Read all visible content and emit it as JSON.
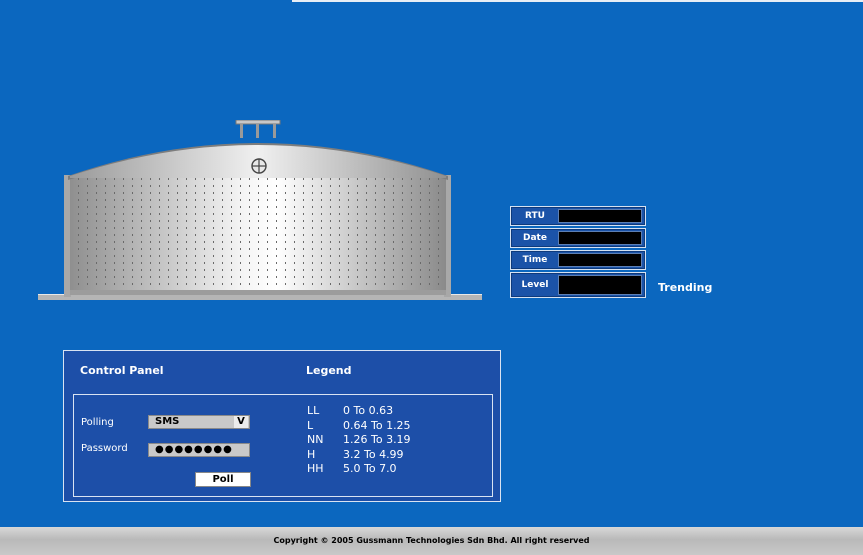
{
  "readout": {
    "rows": [
      {
        "label": "RTU",
        "value": ""
      },
      {
        "label": "Date",
        "value": ""
      },
      {
        "label": "Time",
        "value": ""
      },
      {
        "label": "Level",
        "value": ""
      }
    ],
    "trending_label": "Trending"
  },
  "control_panel": {
    "title": "Control Panel",
    "polling_label": "Polling",
    "polling_value": "SMS",
    "password_label": "Password",
    "password_mask": "●●●●●●●●",
    "poll_button": "Poll"
  },
  "legend": {
    "title": "Legend",
    "items": [
      {
        "code": "LL",
        "range": "0 To 0.63"
      },
      {
        "code": "L",
        "range": "0.64 To 1.25"
      },
      {
        "code": "NN",
        "range": "1.26 To 3.19"
      },
      {
        "code": "H",
        "range": "3.2 To 4.99"
      },
      {
        "code": "HH",
        "range": "5.0 To 7.0"
      }
    ]
  },
  "footer": {
    "copyright": "Copyright © 2005 Gussmann Technologies Sdn Bhd. All right reserved"
  },
  "colors": {
    "background": "#0b67bf",
    "panel": "#1d4fa8",
    "footer": "#c8c8c8"
  }
}
